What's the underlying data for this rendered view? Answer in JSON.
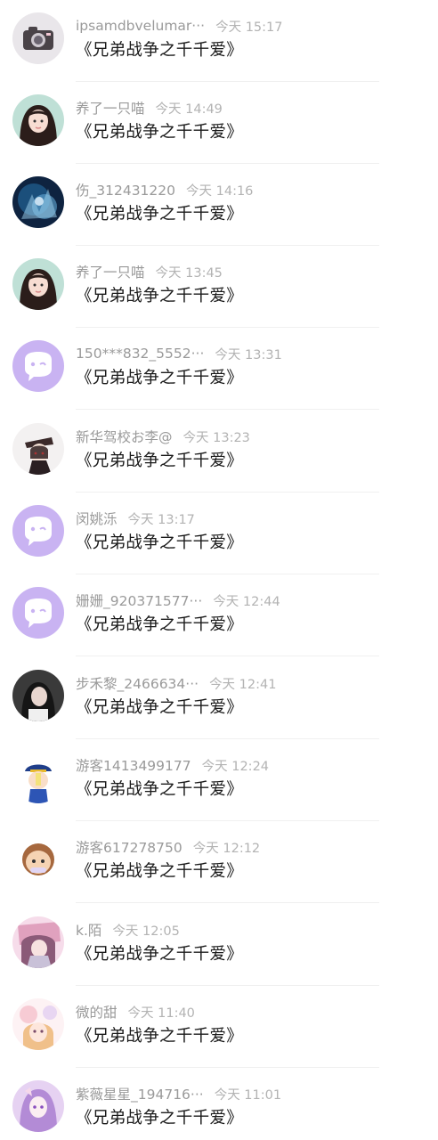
{
  "colors": {
    "name_text": "#9a9a9a",
    "time_text": "#b3b3b3",
    "message_text": "#1a1a1a",
    "default_avatar_bg": "#c7b0f2"
  },
  "items": [
    {
      "name": "ipsamdbvelumar···",
      "time": "今天 15:17",
      "message": "《兄弟战争之千千爱》",
      "avatar": "camera-avatar"
    },
    {
      "name": "养了一只喵",
      "time": "今天 14:49",
      "message": "《兄弟战争之千千爱》",
      "avatar": "girl-photo-avatar"
    },
    {
      "name": "伤_312431220",
      "time": "今天 14:16",
      "message": "《兄弟战争之千千爱》",
      "avatar": "blue-fantasy-avatar"
    },
    {
      "name": "养了一只喵",
      "time": "今天 13:45",
      "message": "《兄弟战争之千千爱》",
      "avatar": "girl-photo-avatar"
    },
    {
      "name": "150***832_5552···",
      "time": "今天 13:31",
      "message": "《兄弟战争之千千爱》",
      "avatar": "default-chat-avatar"
    },
    {
      "name": "新华驾校お李@",
      "time": "今天 13:23",
      "message": "《兄弟战争之千千爱》",
      "avatar": "anime-character-avatar"
    },
    {
      "name": "闵姚泺",
      "time": "今天 13:17",
      "message": "《兄弟战争之千千爱》",
      "avatar": "default-chat-avatar"
    },
    {
      "name": "姗姗_920371577···",
      "time": "今天 12:44",
      "message": "《兄弟战争之千千爱》",
      "avatar": "default-chat-avatar"
    },
    {
      "name": "步禾黎_2466634···",
      "time": "今天 12:41",
      "message": "《兄弟战争之千千爱》",
      "avatar": "dark-photo-avatar"
    },
    {
      "name": "游客1413499177",
      "time": "今天 12:24",
      "message": "《兄弟战争之千千爱》",
      "avatar": "cartoon-qing-avatar"
    },
    {
      "name": "游客617278750",
      "time": "今天 12:12",
      "message": "《兄弟战争之千千爱》",
      "avatar": "cartoon-face-avatar"
    },
    {
      "name": "k.陌",
      "time": "今天 12:05",
      "message": "《兄弟战争之千千爱》",
      "avatar": "pink-anime-avatar"
    },
    {
      "name": "微的甜",
      "time": "今天 11:40",
      "message": "《兄弟战争之千千爱》",
      "avatar": "pastel-anime-avatar"
    },
    {
      "name": "紫薇星星_194716···",
      "time": "今天 11:01",
      "message": "《兄弟战争之千千爱》",
      "avatar": "purple-anime-avatar"
    }
  ]
}
